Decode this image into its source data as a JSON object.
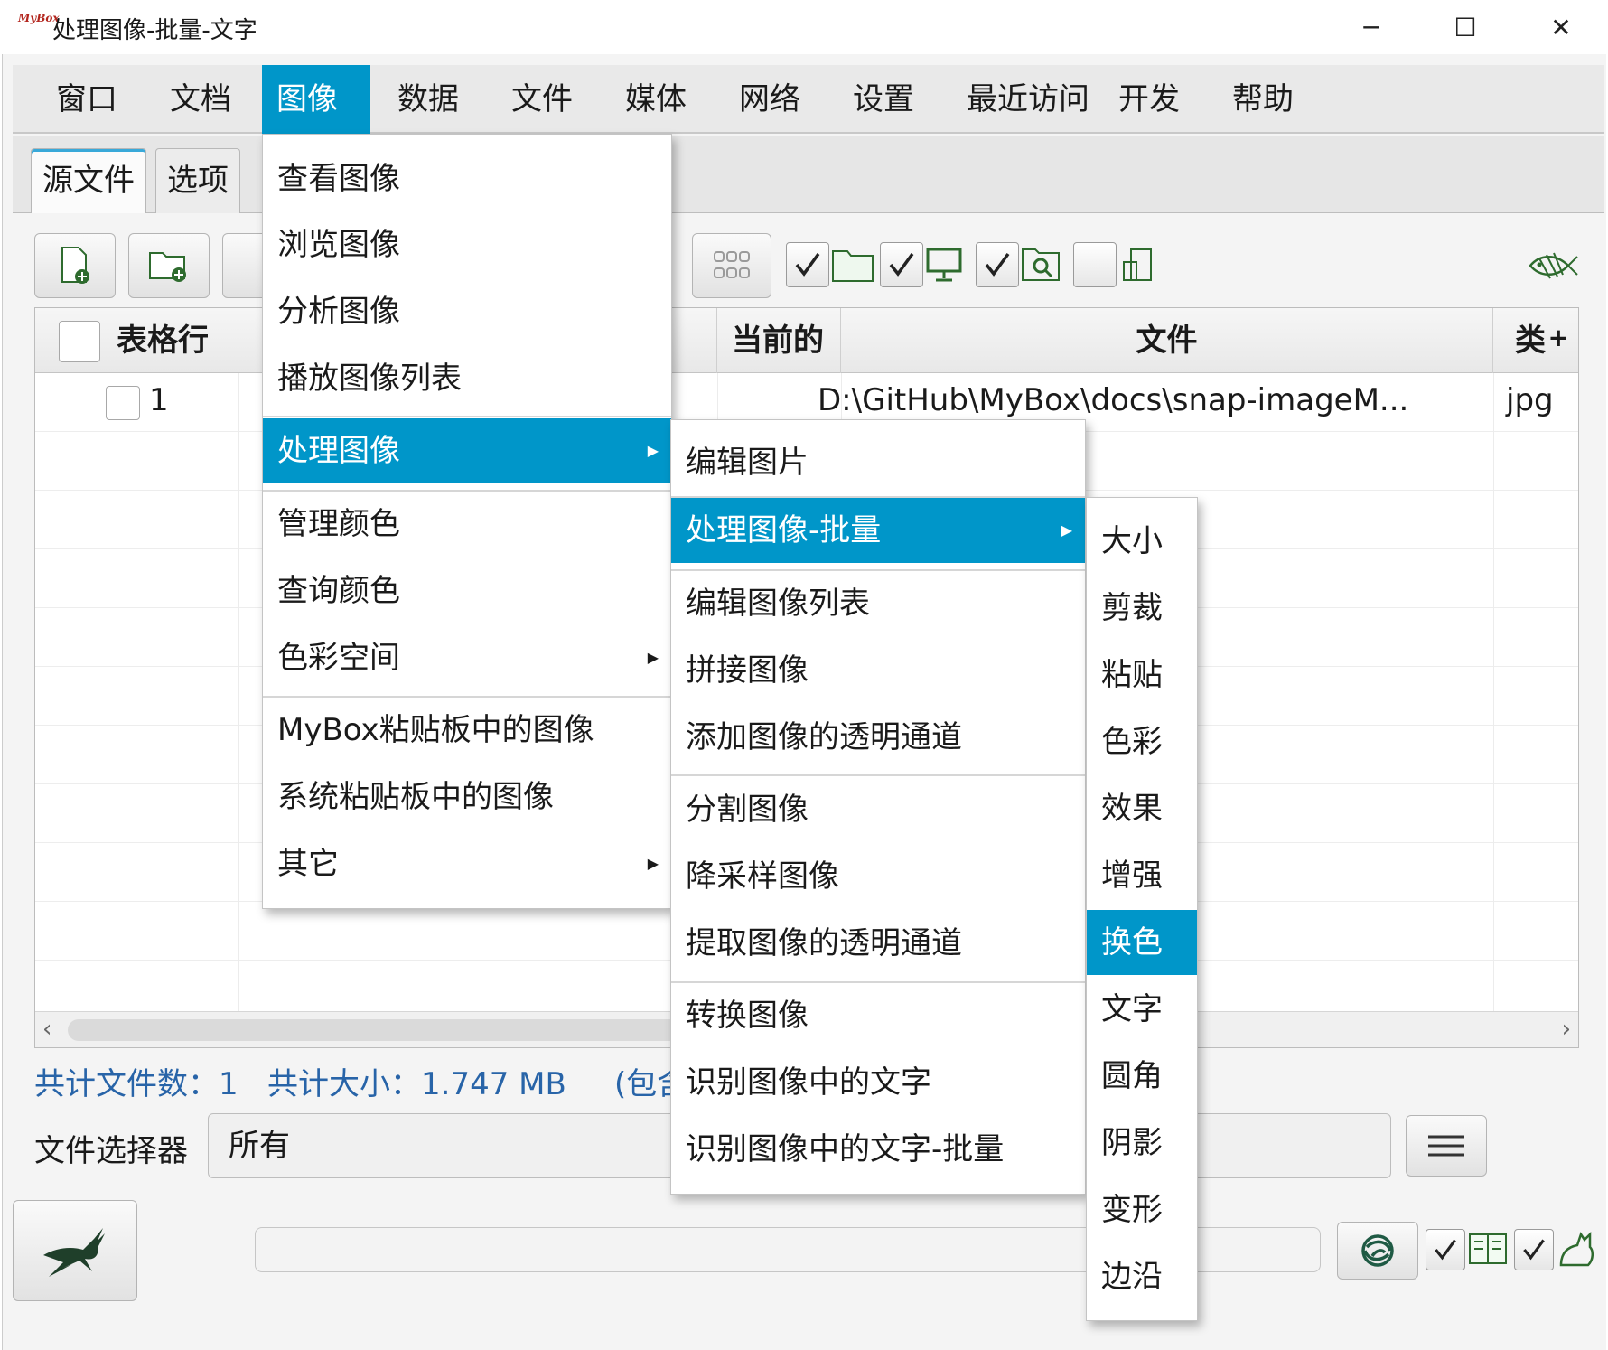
{
  "window": {
    "logo": "MyBox",
    "title": "处理图像-批量-文字",
    "minimize_icon": "─",
    "maximize_icon": "☐",
    "close_icon": "✕"
  },
  "menubar": [
    "窗口",
    "文档",
    "图像",
    "数据",
    "文件",
    "媒体",
    "网络",
    "设置",
    "最近访问",
    "开发",
    "帮助"
  ],
  "menubar_active": "图像",
  "tabs": [
    "源文件",
    "选项"
  ],
  "table": {
    "columns": [
      "表格行",
      "当前的",
      "文件",
      "类"
    ],
    "rows": [
      {
        "index": "1",
        "file": "D:\\GitHub\\MyBox\\docs\\snap-imageM...",
        "type": "jpg"
      }
    ]
  },
  "status": {
    "file_count": "共计文件数：1",
    "total_size": "共计大小：1.747 MB",
    "extra": "(包含"
  },
  "selector": {
    "label": "文件选择器",
    "value": "所有"
  },
  "menu_image": [
    "查看图像",
    "浏览图像",
    "分析图像",
    "播放图像列表",
    "处理图像",
    "管理颜色",
    "查询颜色",
    "色彩空间",
    "MyBox粘贴板中的图像",
    "系统粘贴板中的图像",
    "其它"
  ],
  "menu_process": [
    "编辑图片",
    "处理图像-批量",
    "编辑图像列表",
    "拼接图像",
    "添加图像的透明通道",
    "分割图像",
    "降采样图像",
    "提取图像的透明通道",
    "转换图像",
    "识别图像中的文字",
    "识别图像中的文字-批量"
  ],
  "menu_batch": [
    "大小",
    "剪裁",
    "粘贴",
    "色彩",
    "效果",
    "增强",
    "换色",
    "文字",
    "圆角",
    "阴影",
    "变形",
    "边沿"
  ],
  "colors": {
    "accent": "#0096c9",
    "status_text": "#2864a8"
  }
}
